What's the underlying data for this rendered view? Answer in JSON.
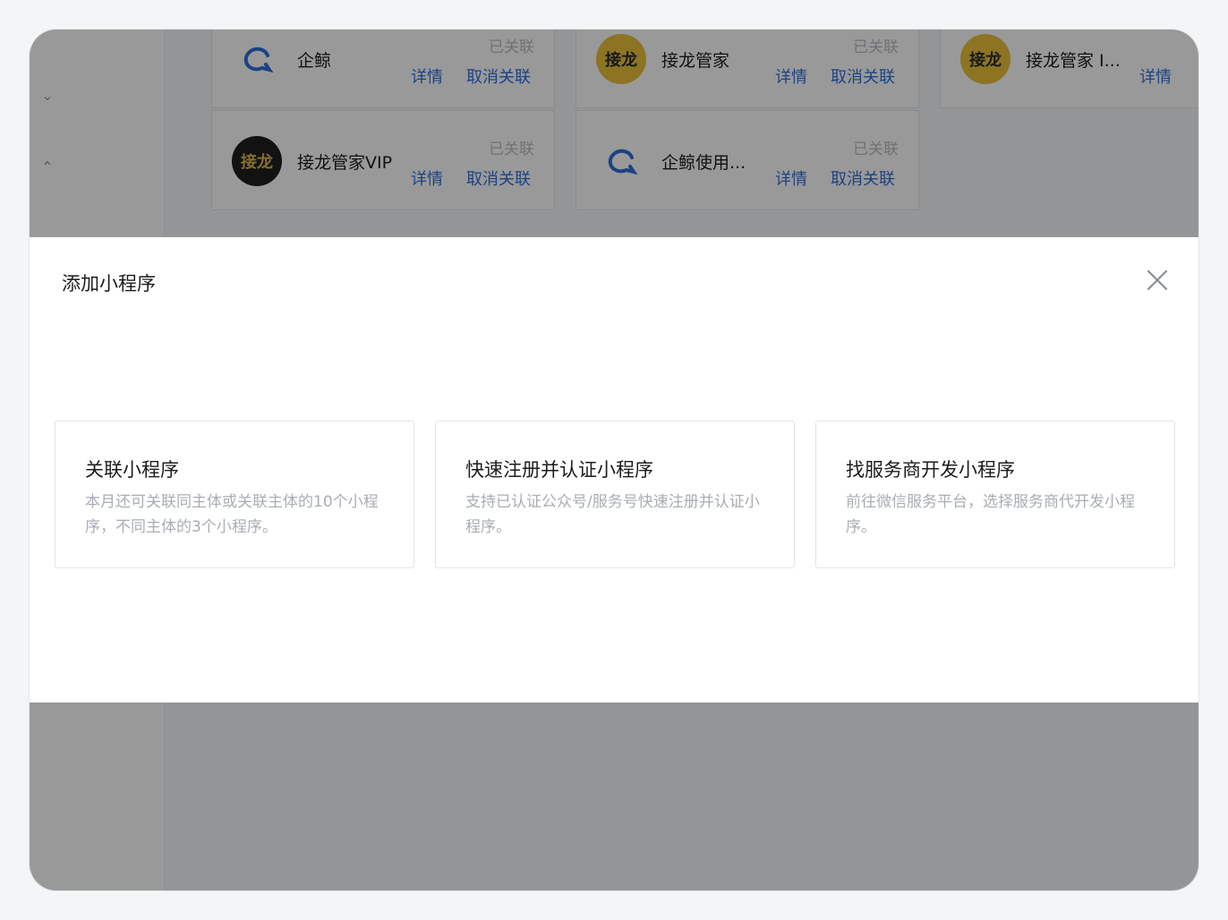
{
  "background_cards": [
    {
      "name": "企鲸",
      "status": "已关联",
      "detail": "详情",
      "unlink": "取消关联",
      "logo": "whale-icon"
    },
    {
      "name": "接龙管家",
      "status": "已关联",
      "detail": "详情",
      "unlink": "取消关联",
      "logo": "jielong-logo",
      "logo_text": "接龙"
    },
    {
      "name": "接龙管家 I...",
      "status": "",
      "detail": "详情",
      "unlink": "",
      "logo": "jielong-logo",
      "logo_text": "接龙"
    },
    {
      "name": "接龙管家VIP",
      "status": "已关联",
      "detail": "详情",
      "unlink": "取消关联",
      "logo": "jielong-vip-logo",
      "logo_text": "接龙"
    },
    {
      "name": "企鲸使用...",
      "status": "已关联",
      "detail": "详情",
      "unlink": "取消关联",
      "logo": "whale-icon"
    }
  ],
  "modal": {
    "title": "添加小程序",
    "close_icon": "close-icon",
    "options": [
      {
        "title": "关联小程序",
        "desc": "本月还可关联同主体或关联主体的10个小程序，不同主体的3个小程序。"
      },
      {
        "title": "快速注册并认证小程序",
        "desc": "支持已认证公众号/服务号快速注册并认证小程序。"
      },
      {
        "title": "找服务商开发小程序",
        "desc": "前往微信服务平台，选择服务商代开发小程序。"
      }
    ]
  },
  "colors": {
    "link": "#2f6fdd",
    "overlay": "rgba(0,0,0,0.40)",
    "logo_yellow": "#e9c23b"
  }
}
